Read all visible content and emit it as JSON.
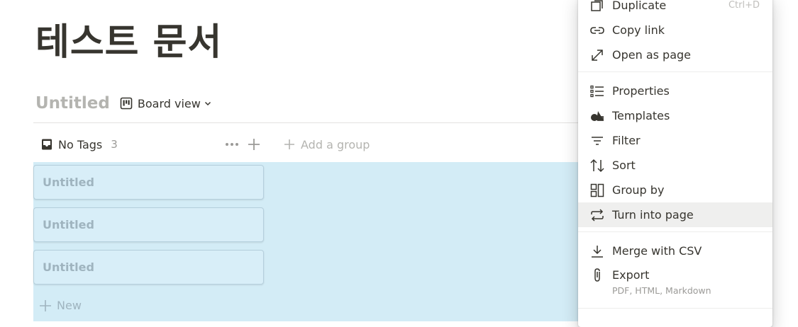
{
  "page": {
    "title": "테스트 문서"
  },
  "database": {
    "title": "Untitled",
    "view_label": "Board view"
  },
  "board": {
    "group_label": "No Tags",
    "group_count": "3",
    "add_group_label": "Add a group",
    "cards": [
      "Untitled",
      "Untitled",
      "Untitled"
    ],
    "new_label": "New",
    "board_color": "#d3ecf6"
  },
  "menu": {
    "items": [
      {
        "label": "Duplicate",
        "shortcut": "Ctrl+D",
        "icon": "duplicate-icon"
      },
      {
        "label": "Copy link",
        "icon": "link-icon"
      },
      {
        "label": "Open as page",
        "icon": "expand-arrow-icon"
      },
      {
        "label": "Properties",
        "icon": "list-icon"
      },
      {
        "label": "Templates",
        "icon": "shapes-icon"
      },
      {
        "label": "Filter",
        "icon": "filter-icon"
      },
      {
        "label": "Sort",
        "icon": "sort-icon"
      },
      {
        "label": "Group by",
        "icon": "group-by-icon"
      },
      {
        "label": "Turn into page",
        "icon": "repeat-icon",
        "highlighted": true
      },
      {
        "label": "Merge with CSV",
        "icon": "download-icon"
      },
      {
        "label": "Export",
        "sublabel": "PDF, HTML, Markdown",
        "icon": "paperclip-icon"
      }
    ]
  }
}
